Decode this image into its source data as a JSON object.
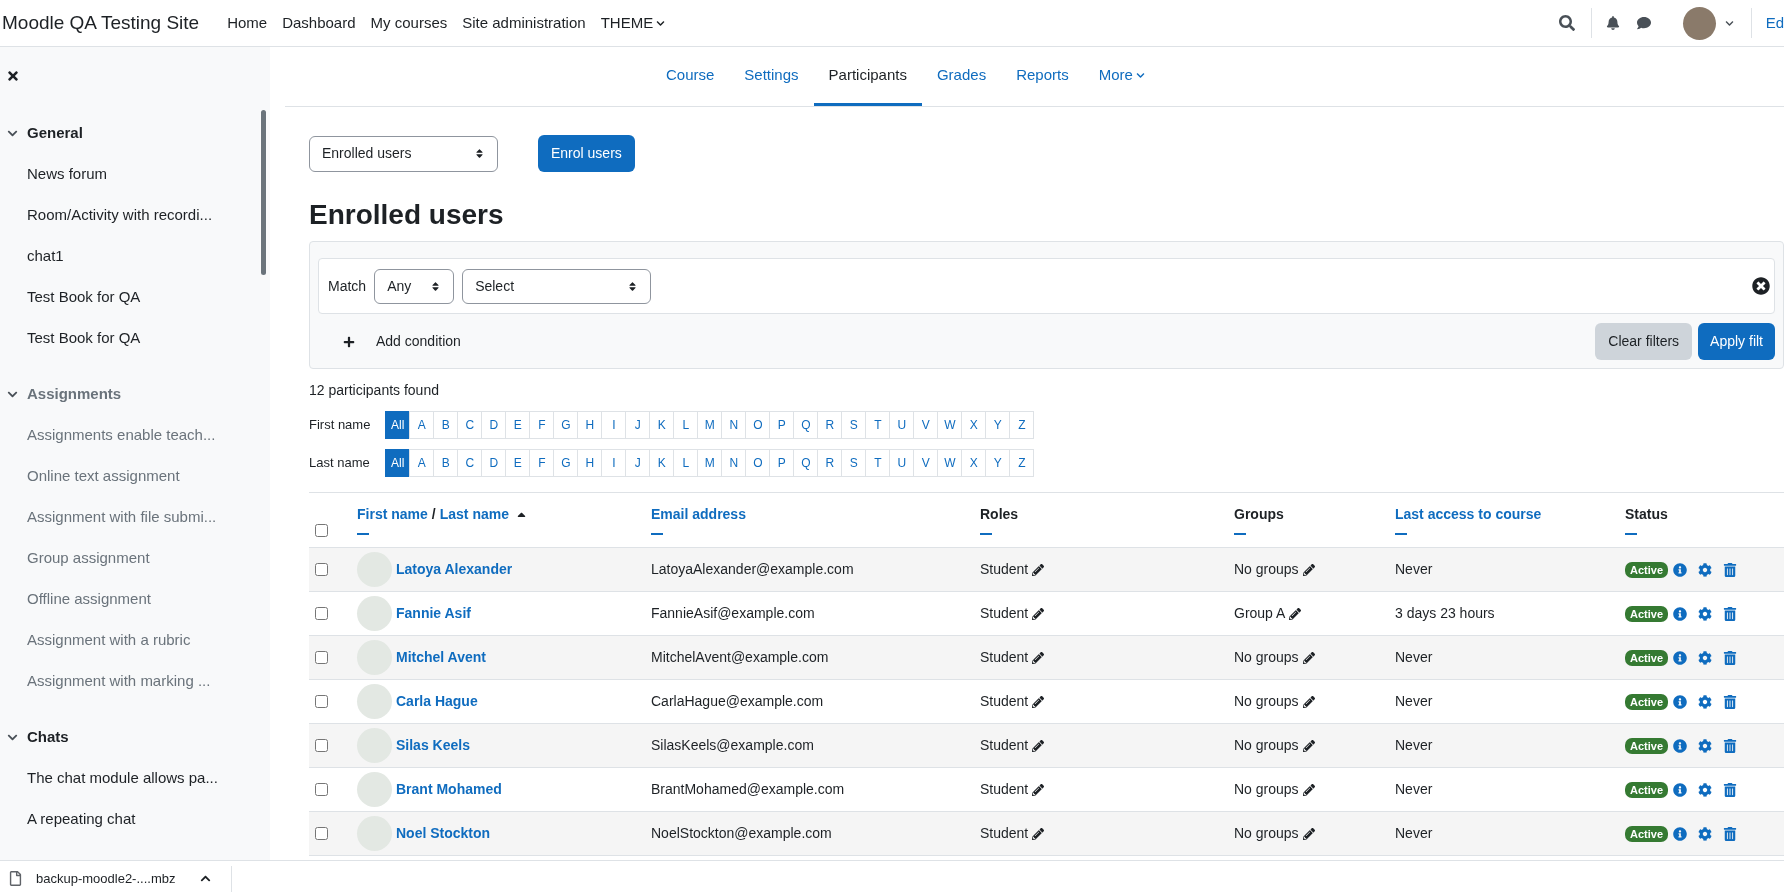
{
  "navbar": {
    "site_name": "Moodle QA Testing Site",
    "links": [
      {
        "label": "Home",
        "dropdown": false
      },
      {
        "label": "Dashboard",
        "dropdown": false
      },
      {
        "label": "My courses",
        "dropdown": false
      },
      {
        "label": "Site administration",
        "dropdown": false
      },
      {
        "label": "THEME",
        "dropdown": true
      }
    ],
    "user_menu_text": "Ed"
  },
  "sidebar": {
    "sections": [
      {
        "title": "General",
        "expanded": true,
        "dimmed": false,
        "items": [
          {
            "label": "News forum",
            "dimmed": false
          },
          {
            "label": "Room/Activity with recordi...",
            "dimmed": false
          },
          {
            "label": "chat1",
            "dimmed": false
          },
          {
            "label": "Test Book for QA",
            "dimmed": false
          },
          {
            "label": "Test Book for QA",
            "dimmed": false
          }
        ]
      },
      {
        "title": "Assignments",
        "expanded": true,
        "dimmed": true,
        "items": [
          {
            "label": "Assignments enable teach...",
            "dimmed": true
          },
          {
            "label": "Online text assignment",
            "dimmed": true
          },
          {
            "label": "Assignment with file submi...",
            "dimmed": true
          },
          {
            "label": "Group assignment",
            "dimmed": true
          },
          {
            "label": "Offline assignment",
            "dimmed": true
          },
          {
            "label": "Assignment with a rubric",
            "dimmed": true
          },
          {
            "label": "Assignment with marking ...",
            "dimmed": true
          }
        ]
      },
      {
        "title": "Chats",
        "expanded": true,
        "dimmed": false,
        "items": [
          {
            "label": "The chat module allows pa...",
            "dimmed": false
          },
          {
            "label": "A repeating chat",
            "dimmed": false
          }
        ]
      }
    ]
  },
  "secondary_nav": {
    "tabs": [
      {
        "label": "Course",
        "selected": false,
        "dropdown": false
      },
      {
        "label": "Settings",
        "selected": false,
        "dropdown": false
      },
      {
        "label": "Participants",
        "selected": true,
        "dropdown": false
      },
      {
        "label": "Grades",
        "selected": false,
        "dropdown": false
      },
      {
        "label": "Reports",
        "selected": false,
        "dropdown": false
      },
      {
        "label": "More",
        "selected": false,
        "dropdown": true
      }
    ]
  },
  "page": {
    "view_select": "Enrolled users",
    "enrol_button": "Enrol users",
    "heading": "Enrolled users"
  },
  "filter": {
    "match_label": "Match",
    "match_value": "Any",
    "condition_value": "Select",
    "add_condition": "Add condition",
    "clear_button": "Clear filters",
    "apply_button": "Apply filt"
  },
  "participants_count": "12 participants found",
  "initials_bars": [
    {
      "label": "First name",
      "letters": [
        {
          "label": "All",
          "selected": true
        },
        {
          "label": "A",
          "selected": false
        },
        {
          "label": "B",
          "selected": false
        },
        {
          "label": "C",
          "selected": false
        },
        {
          "label": "D",
          "selected": false
        },
        {
          "label": "E",
          "selected": false
        },
        {
          "label": "F",
          "selected": false
        },
        {
          "label": "G",
          "selected": false
        },
        {
          "label": "H",
          "selected": false
        },
        {
          "label": "I",
          "selected": false
        },
        {
          "label": "J",
          "selected": false
        },
        {
          "label": "K",
          "selected": false
        },
        {
          "label": "L",
          "selected": false
        },
        {
          "label": "M",
          "selected": false
        },
        {
          "label": "N",
          "selected": false
        },
        {
          "label": "O",
          "selected": false
        },
        {
          "label": "P",
          "selected": false
        },
        {
          "label": "Q",
          "selected": false
        },
        {
          "label": "R",
          "selected": false
        },
        {
          "label": "S",
          "selected": false
        },
        {
          "label": "T",
          "selected": false
        },
        {
          "label": "U",
          "selected": false
        },
        {
          "label": "V",
          "selected": false
        },
        {
          "label": "W",
          "selected": false
        },
        {
          "label": "X",
          "selected": false
        },
        {
          "label": "Y",
          "selected": false
        },
        {
          "label": "Z",
          "selected": false
        }
      ]
    },
    {
      "label": "Last name",
      "letters": [
        {
          "label": "All",
          "selected": true
        },
        {
          "label": "A",
          "selected": false
        },
        {
          "label": "B",
          "selected": false
        },
        {
          "label": "C",
          "selected": false
        },
        {
          "label": "D",
          "selected": false
        },
        {
          "label": "E",
          "selected": false
        },
        {
          "label": "F",
          "selected": false
        },
        {
          "label": "G",
          "selected": false
        },
        {
          "label": "H",
          "selected": false
        },
        {
          "label": "I",
          "selected": false
        },
        {
          "label": "J",
          "selected": false
        },
        {
          "label": "K",
          "selected": false
        },
        {
          "label": "L",
          "selected": false
        },
        {
          "label": "M",
          "selected": false
        },
        {
          "label": "N",
          "selected": false
        },
        {
          "label": "O",
          "selected": false
        },
        {
          "label": "P",
          "selected": false
        },
        {
          "label": "Q",
          "selected": false
        },
        {
          "label": "R",
          "selected": false
        },
        {
          "label": "S",
          "selected": false
        },
        {
          "label": "T",
          "selected": false
        },
        {
          "label": "U",
          "selected": false
        },
        {
          "label": "V",
          "selected": false
        },
        {
          "label": "W",
          "selected": false
        },
        {
          "label": "X",
          "selected": false
        },
        {
          "label": "Y",
          "selected": false
        },
        {
          "label": "Z",
          "selected": false
        }
      ]
    }
  ],
  "table": {
    "select_all_checked": false,
    "columns": [
      {
        "kind": "name",
        "first": "First name",
        "separator": "/",
        "last": "Last name",
        "sorted": true
      },
      {
        "kind": "link",
        "label": "Email address",
        "sorted": false
      },
      {
        "kind": "plain",
        "label": "Roles",
        "sorted": false
      },
      {
        "kind": "plain",
        "label": "Groups",
        "sorted": false
      },
      {
        "kind": "link",
        "label": "Last access to course",
        "sorted": false
      },
      {
        "kind": "plain",
        "label": "Status",
        "sorted": false
      }
    ],
    "rows": [
      {
        "checked": false,
        "name": "Latoya Alexander",
        "email": "LatoyaAlexander@example.com",
        "role": "Student",
        "groups": "No groups",
        "last_access": "Never",
        "status": "Active"
      },
      {
        "checked": false,
        "name": "Fannie Asif",
        "email": "FannieAsif@example.com",
        "role": "Student",
        "groups": "Group A",
        "last_access": "3 days 23 hours",
        "status": "Active"
      },
      {
        "checked": false,
        "name": "Mitchel Avent",
        "email": "MitchelAvent@example.com",
        "role": "Student",
        "groups": "No groups",
        "last_access": "Never",
        "status": "Active"
      },
      {
        "checked": false,
        "name": "Carla Hague",
        "email": "CarlaHague@example.com",
        "role": "Student",
        "groups": "No groups",
        "last_access": "Never",
        "status": "Active"
      },
      {
        "checked": false,
        "name": "Silas Keels",
        "email": "SilasKeels@example.com",
        "role": "Student",
        "groups": "No groups",
        "last_access": "Never",
        "status": "Active"
      },
      {
        "checked": false,
        "name": "Brant Mohamed",
        "email": "BrantMohamed@example.com",
        "role": "Student",
        "groups": "No groups",
        "last_access": "Never",
        "status": "Active"
      },
      {
        "checked": false,
        "name": "Noel Stockton",
        "email": "NoelStockton@example.com",
        "role": "Student",
        "groups": "No groups",
        "last_access": "Never",
        "status": "Active"
      }
    ]
  },
  "download_bar": {
    "file_name": "backup-moodle2-....mbz"
  }
}
